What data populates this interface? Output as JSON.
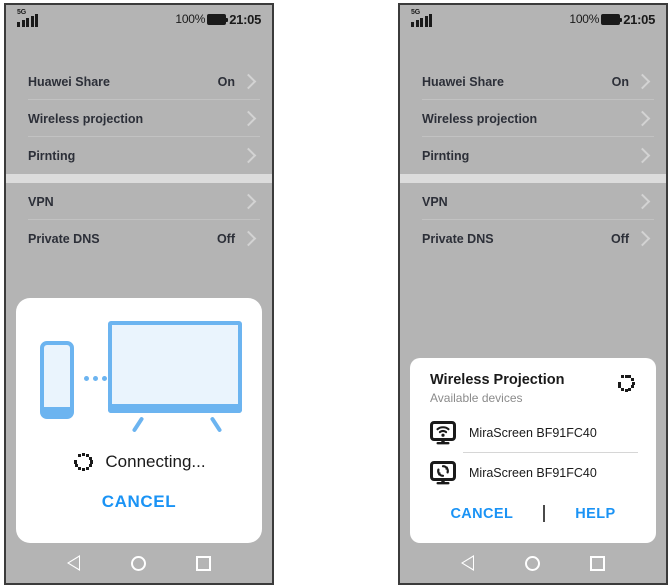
{
  "status_bar": {
    "network_label": "5G",
    "battery_percent": "100%",
    "clock": "21:05",
    "signal_icon": "signal-bars-icon",
    "battery_icon": "battery-full-icon"
  },
  "settings": {
    "group1": [
      {
        "label": "Huawei Share",
        "value": "On"
      },
      {
        "label": "Wireless projection",
        "value": ""
      },
      {
        "label": "Pirnting",
        "value": ""
      }
    ],
    "group2": [
      {
        "label": "VPN",
        "value": ""
      },
      {
        "label": "Private DNS",
        "value": "Off"
      }
    ]
  },
  "nav_bar": {
    "back": "back-icon",
    "home": "home-icon",
    "recents": "recents-icon"
  },
  "connecting_dialog": {
    "illustration": {
      "phone_icon": "phone-device-icon",
      "dots_icon": "transfer-dots-icon",
      "tv_icon": "tv-device-icon"
    },
    "spinner_icon": "loading-spinner-icon",
    "status_text": "Connecting...",
    "cancel_label": "CANCEL"
  },
  "devices_dialog": {
    "title": "Wireless Projection",
    "subtitle": "Available devices",
    "spinner_icon": "loading-spinner-icon",
    "devices": [
      {
        "name": "MiraScreen BF91FC40",
        "icon": "monitor-wifi-icon"
      },
      {
        "name": "MiraScreen BF91FC40",
        "icon": "monitor-cast-icon"
      }
    ],
    "cancel_label": "CANCEL",
    "help_label": "HELP"
  },
  "colors": {
    "phone_background": "#b4b4b4",
    "group_separator": "#dcdcdc",
    "accent_blue": "#1a93f5",
    "illustration_blue": "#6cb4f0",
    "illustration_fill": "#eaf4fd",
    "text_dark": "#2c2f38"
  }
}
